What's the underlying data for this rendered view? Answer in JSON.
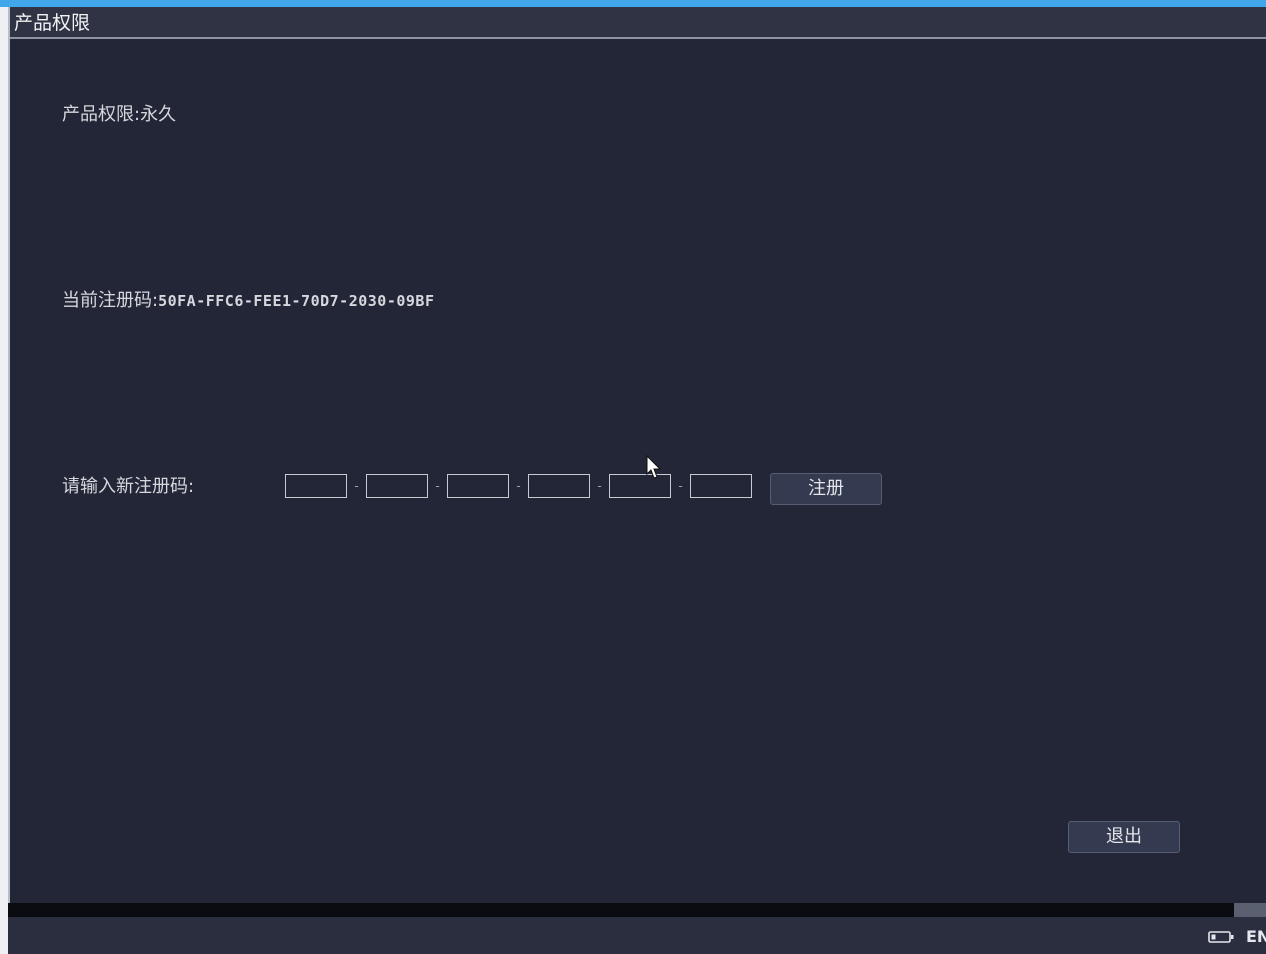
{
  "window": {
    "title": "产品权限"
  },
  "permission": {
    "label": "产品权限:永久"
  },
  "current_code": {
    "label": "当前注册码:",
    "value": "50FA-FFC6-FEE1-70D7-2030-09BF"
  },
  "new_code": {
    "label": "请输入新注册码:",
    "fields": [
      "",
      "",
      "",
      "",
      "",
      ""
    ],
    "separator": "-",
    "register_label": "注册"
  },
  "footer": {
    "exit_label": "退出"
  },
  "taskbar": {
    "battery_icon": "battery-icon",
    "language": "EN"
  },
  "colors": {
    "accent": "#41a6ea",
    "window_bg": "#232636",
    "button_bg": "#343a4f"
  }
}
